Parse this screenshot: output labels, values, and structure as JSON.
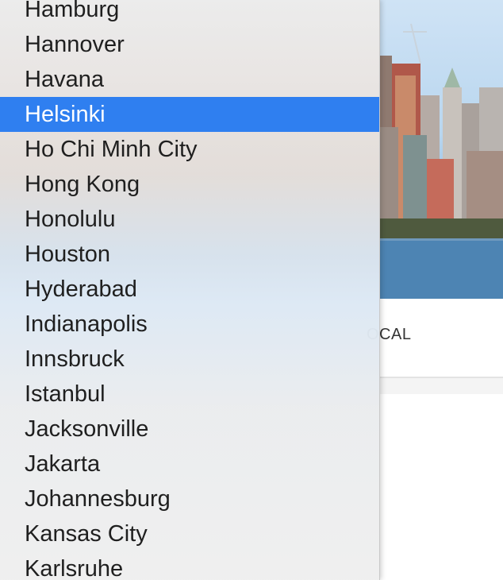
{
  "background_page": {
    "partial_label": "OCAL",
    "photo": "city-skyline-photo"
  },
  "dropdown": {
    "selected_index": 3,
    "selected_color": "#2f7ff0",
    "items": [
      {
        "label": "Hamburg"
      },
      {
        "label": "Hannover"
      },
      {
        "label": "Havana"
      },
      {
        "label": "Helsinki"
      },
      {
        "label": "Ho Chi Minh City"
      },
      {
        "label": "Hong Kong"
      },
      {
        "label": "Honolulu"
      },
      {
        "label": "Houston"
      },
      {
        "label": "Hyderabad"
      },
      {
        "label": "Indianapolis"
      },
      {
        "label": "Innsbruck"
      },
      {
        "label": "Istanbul"
      },
      {
        "label": "Jacksonville"
      },
      {
        "label": "Jakarta"
      },
      {
        "label": "Johannesburg"
      },
      {
        "label": "Kansas City"
      },
      {
        "label": "Karlsruhe"
      }
    ]
  }
}
